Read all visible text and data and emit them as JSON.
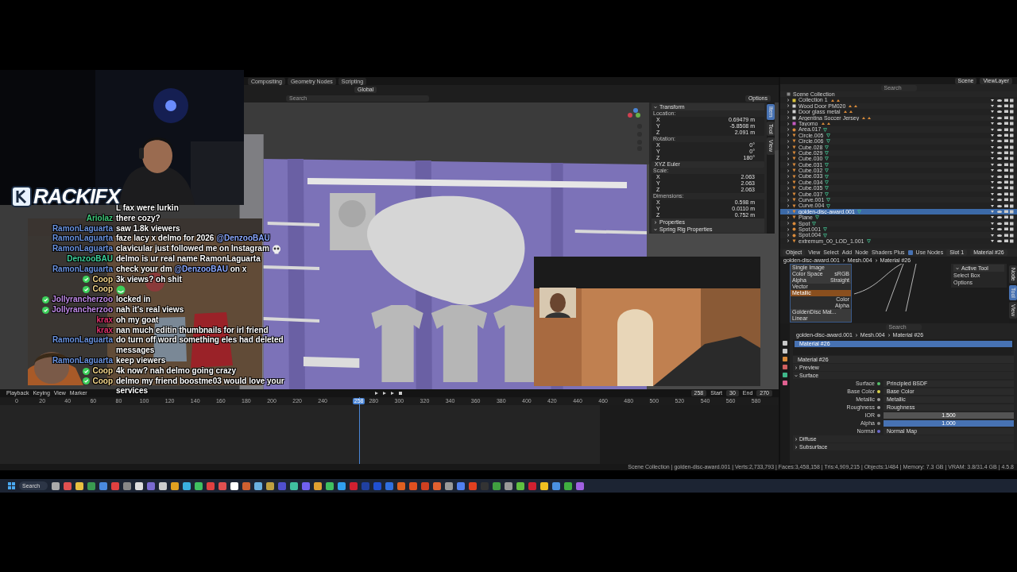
{
  "logo": {
    "text": "RACKIFX"
  },
  "chat": [
    {
      "badge": false,
      "parts": [
        {
          "text": "L fax were lurkin"
        }
      ]
    },
    {
      "user": "Ariolaz",
      "color": "#3fc97a",
      "badge": false,
      "parts": [
        {
          "text": "there cozy?"
        }
      ]
    },
    {
      "user": "RamonLaguarta",
      "color": "#6a93e0",
      "badge": false,
      "parts": [
        {
          "text": "saw 1.8k viewers"
        }
      ]
    },
    {
      "user": "RamonLaguarta",
      "color": "#6a93e0",
      "badge": false,
      "parts": [
        {
          "text": "faze lacy x delmo for 2026 "
        },
        {
          "text": "@DenzooBAU",
          "kind": "mention"
        }
      ]
    },
    {
      "user": "RamonLaguarta",
      "color": "#6a93e0",
      "badge": false,
      "parts": [
        {
          "text": "clavicular just followed me on Instagram"
        }
      ],
      "emote": {
        "kind": "skull"
      }
    },
    {
      "user": "DenzooBAU",
      "color": "#3ecf9a",
      "badge": false,
      "parts": [
        {
          "text": "delmo is ur real name RamonLaguarta"
        }
      ]
    },
    {
      "user": "RamonLaguarta",
      "color": "#6a93e0",
      "badge": false,
      "parts": [
        {
          "text": "check your dm "
        },
        {
          "text": "@DenzooBAU",
          "kind": "mention"
        },
        {
          "text": " on x"
        }
      ]
    },
    {
      "user": "Coop",
      "color": "#f3d58a",
      "badge": true,
      "parts": [
        {
          "text": "3k views? oh shit"
        }
      ]
    },
    {
      "user": "Coop",
      "color": "#f3d58a",
      "badge": true,
      "emote": {
        "kind": "face"
      }
    },
    {
      "user": "Jollyrancherzoo",
      "color": "#c08ae8",
      "badge": true,
      "parts": [
        {
          "text": "locked in"
        }
      ]
    },
    {
      "user": "Jollyrancherzoo",
      "color": "#c08ae8",
      "badge": true,
      "parts": [
        {
          "text": "nah it's real views"
        }
      ]
    },
    {
      "user": "krax",
      "color": "#e2336e",
      "badge": false,
      "parts": [
        {
          "text": "oh my goat"
        }
      ]
    },
    {
      "user": "krax",
      "color": "#e2336e",
      "badge": false,
      "parts": [
        {
          "text": "nan much editin thumbnails for irl friend"
        }
      ]
    },
    {
      "user": "RamonLaguarta",
      "color": "#6a93e0",
      "badge": false,
      "parts": [
        {
          "text": "do turn off word something eles had deleted messages"
        }
      ]
    },
    {
      "user": "RamonLaguarta",
      "color": "#6a93e0",
      "badge": false,
      "parts": [
        {
          "text": "keep viewers"
        }
      ]
    },
    {
      "user": "Coop",
      "color": "#f3d58a",
      "badge": true,
      "parts": [
        {
          "text": "4k now? nah delmo going crazy"
        }
      ]
    },
    {
      "user": "Coop",
      "color": "#f3d58a",
      "badge": true,
      "parts": [
        {
          "text": "delmo my friend boostme03 would love your services"
        }
      ]
    }
  ],
  "blender": {
    "workspace_tabs": [
      {
        "label": "Compositing",
        "selected": false
      },
      {
        "label": "Geometry Nodes",
        "selected": false
      },
      {
        "label": "Scripting",
        "selected": false
      }
    ],
    "viewport_header": {
      "orientation": "Global",
      "search_placeholder": "Search",
      "options": "Options"
    },
    "n_panel": {
      "tabs": [
        {
          "label": "Item",
          "selected": true
        },
        {
          "label": "Tool",
          "selected": false
        },
        {
          "label": "View",
          "selected": false
        }
      ],
      "title": "Transform",
      "groups": [
        {
          "label": "Location:",
          "rows": [
            {
              "axis": "X",
              "value": "0.69479 m"
            },
            {
              "axis": "Y",
              "value": "-5.8508 m"
            },
            {
              "axis": "Z",
              "value": "2.091 m"
            }
          ]
        },
        {
          "label": "Rotation:",
          "rows": [
            {
              "axis": "X",
              "value": "0°"
            },
            {
              "axis": "Y",
              "value": "0°"
            },
            {
              "axis": "Z",
              "value": "180°"
            }
          ],
          "dropdown": "XYZ Euler"
        },
        {
          "label": "Scale:",
          "rows": [
            {
              "axis": "X",
              "value": "2.063"
            },
            {
              "axis": "Y",
              "value": "2.063"
            },
            {
              "axis": "Z",
              "value": "2.063"
            }
          ]
        },
        {
          "label": "Dimensions:",
          "rows": [
            {
              "axis": "X",
              "value": "0.598 m"
            },
            {
              "axis": "Y",
              "value": "0.0110 m"
            },
            {
              "axis": "Z",
              "value": "0.752 m"
            }
          ]
        }
      ],
      "sections": [
        {
          "label": "Properties",
          "expanded": false
        },
        {
          "label": "Spring Rig Properties",
          "expanded": true
        }
      ]
    },
    "timeline": {
      "menus": [
        "Playback",
        "Keying",
        "View",
        "Marker"
      ],
      "tick_runs": [
        [
          "0",
          "20",
          "40",
          "60",
          "80",
          "100",
          "120",
          "140",
          "160",
          "180",
          "200",
          "220",
          "240"
        ],
        [
          "280",
          "300",
          "320",
          "340",
          "360",
          "380",
          "400",
          "420",
          "440",
          "460",
          "480",
          "500",
          "520",
          "540",
          "560",
          "580"
        ]
      ],
      "playhead": {
        "label": "258",
        "level": 0.462
      },
      "frame": "258",
      "start_label": "Start",
      "start": "30",
      "end_label": "End",
      "end": "270"
    },
    "outliner": {
      "scene": "Scene",
      "view_layer": "ViewLayer",
      "search_placeholder": "Search",
      "root": "Scene Collection",
      "rows": [
        {
          "name": "Collection 1",
          "kind": "collection",
          "color": "#d8c23a",
          "selected": false
        },
        {
          "name": "Wood Door PM020",
          "kind": "collection",
          "color": "#cfcfcf",
          "selected": false
        },
        {
          "name": "Door glass metal",
          "kind": "collection",
          "color": "#cfcfcf",
          "selected": false
        },
        {
          "name": "Argentina Soccer Jersey",
          "kind": "collection",
          "color": "#cfcfcf",
          "selected": false
        },
        {
          "name": "Tayomo",
          "kind": "collection",
          "color": "#c45ac0",
          "selected": false
        },
        {
          "name": "Area.017",
          "kind": "light",
          "selected": false
        },
        {
          "name": "Circle.005",
          "kind": "mesh",
          "selected": false
        },
        {
          "name": "Circle.006",
          "kind": "mesh",
          "selected": false
        },
        {
          "name": "Cube.028",
          "kind": "mesh",
          "selected": false
        },
        {
          "name": "Cube.029",
          "kind": "mesh",
          "selected": false
        },
        {
          "name": "Cube.030",
          "kind": "mesh",
          "selected": false
        },
        {
          "name": "Cube.031",
          "kind": "mesh",
          "selected": false
        },
        {
          "name": "Cube.032",
          "kind": "mesh",
          "selected": false
        },
        {
          "name": "Cube.033",
          "kind": "mesh",
          "selected": false
        },
        {
          "name": "Cube.034",
          "kind": "mesh",
          "selected": false
        },
        {
          "name": "Cube.035",
          "kind": "mesh",
          "selected": false
        },
        {
          "name": "Cube.037",
          "kind": "mesh",
          "selected": false
        },
        {
          "name": "Curve.001",
          "kind": "mesh",
          "selected": false
        },
        {
          "name": "Curve.004",
          "kind": "mesh",
          "selected": false
        },
        {
          "name": "golden-disc-award.001",
          "kind": "mesh",
          "selected": true
        },
        {
          "name": "Plane",
          "kind": "mesh",
          "selected": false
        },
        {
          "name": "Spot",
          "kind": "light",
          "selected": false
        },
        {
          "name": "Spot.001",
          "kind": "light",
          "selected": false
        },
        {
          "name": "Spot.004",
          "kind": "light",
          "selected": false
        },
        {
          "name": "extremum_00_LOD_1.001",
          "kind": "mesh",
          "selected": false
        }
      ]
    },
    "node_editor": {
      "mode": "Object",
      "menus": [
        "View",
        "Select",
        "Add",
        "Node",
        "Shaders Plus"
      ],
      "use_nodes": {
        "label": "Use Nodes",
        "checked": true
      },
      "slot": "Slot 1",
      "material": "Material #26",
      "breadcrumb": [
        "golden-disc-award.001",
        "Mesh.004",
        "Material #26"
      ],
      "node": {
        "fields": [
          {
            "label": "Single Image"
          },
          {
            "label": "Color Space",
            "value": "sRGB"
          },
          {
            "label": "Alpha",
            "value": "Straight"
          }
        ],
        "input": "Vector",
        "title": "Metallic",
        "outputs": [
          "Color",
          "Alpha"
        ],
        "image": "GoldenDisc Mat...",
        "interpolation": "Linear"
      },
      "active_tool": {
        "title": "Active Tool",
        "tool": "Select Box",
        "options": "Options"
      },
      "tabs": [
        {
          "label": "Node",
          "selected": false
        },
        {
          "label": "Tool",
          "selected": true
        },
        {
          "label": "View",
          "selected": false
        }
      ]
    },
    "properties": {
      "search_placeholder": "Search",
      "breadcrumb": [
        "golden-disc-award.001",
        "Mesh.004",
        "Material #26"
      ],
      "slots": [
        {
          "label": "Material #26",
          "selected": true
        }
      ],
      "material": "Material #26",
      "panels": [
        {
          "label": "Preview",
          "expanded": false
        },
        {
          "label": "Surface",
          "expanded": true
        }
      ],
      "props": [
        {
          "label": "Surface",
          "value": "Principled BSDF",
          "kind": "link",
          "color": "#55c06a"
        },
        {
          "label": "Base Color",
          "value": "Base Color",
          "kind": "link",
          "color": "#d9d34a"
        },
        {
          "label": "Metallic",
          "value": "Metallic",
          "kind": "link",
          "color": "#9a9a9a"
        },
        {
          "label": "Roughness",
          "value": "Roughness",
          "kind": "link",
          "color": "#9a9a9a"
        },
        {
          "label": "IOR",
          "value": "1.500",
          "kind": "slider",
          "level": 0
        },
        {
          "label": "Alpha",
          "value": "1.000",
          "kind": "slider",
          "level": 1
        },
        {
          "label": "Normal",
          "value": "Normal Map",
          "kind": "link",
          "color": "#6b6bd0"
        }
      ],
      "subpanels": [
        {
          "label": "Diffuse",
          "expanded": false
        },
        {
          "label": "Subsurface",
          "expanded": false
        }
      ]
    },
    "status_bar": "Scene Collection | golden-disc-award.001 | Verts:2,733,793 | Faces:3,458,158 | Tris:4,909,215 | Objects:1/484 | Memory: 7.3 GB | VRAM: 3.8/31.4 GB | 4.5.8"
  },
  "taskbar": {
    "search": "Search"
  }
}
